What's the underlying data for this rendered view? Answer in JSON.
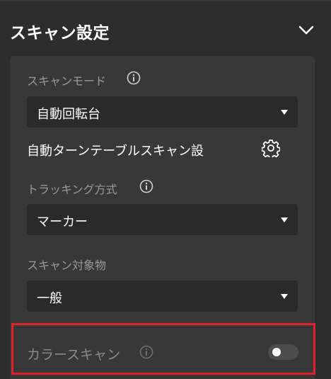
{
  "header": {
    "title": "スキャン設定"
  },
  "scan_mode": {
    "label": "スキャンモード",
    "value": "自動回転台"
  },
  "turntable": {
    "label": "自動ターンテーブルスキャン設"
  },
  "tracking": {
    "label": "トラッキング方式",
    "value": "マーカー"
  },
  "target": {
    "label": "スキャン対象物",
    "value": "一般"
  },
  "color_scan": {
    "label": "カラースキャン",
    "enabled": false
  },
  "colors": {
    "background": "#2d2d2d",
    "panel": "#383838",
    "field": "#2a2a2a",
    "highlight": "#e0202b"
  }
}
